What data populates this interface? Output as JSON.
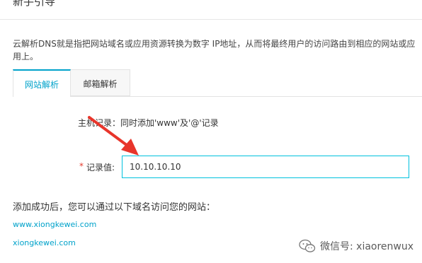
{
  "page": {
    "title": "新手引导"
  },
  "intro": {
    "description": "云解析DNS就是指把网站域名或应用资源转换为数字 IP地址，从而将最终用户的访问路由到相应的网站或应用上。"
  },
  "tabs": [
    {
      "label": "网站解析",
      "active": true
    },
    {
      "label": "邮箱解析",
      "active": false
    }
  ],
  "host_record": {
    "text": "主机记录：同时添加'www'及'@'记录"
  },
  "record_value": {
    "required_mark": "*",
    "label": "记录值:",
    "value": "10.10.10.10"
  },
  "result": {
    "hint": "添加成功后，您可以通过以下域名访问您的网站：",
    "links": [
      "www.xiongkewei.com",
      "xiongkewei.com"
    ]
  },
  "watermark": {
    "text": "微信号: xiaorenwux"
  },
  "annotation": {
    "arrow_color": "#e8352b"
  },
  "colors": {
    "accent": "#00a2ca",
    "input_border": "#00c1de",
    "required": "#e43b2e"
  }
}
